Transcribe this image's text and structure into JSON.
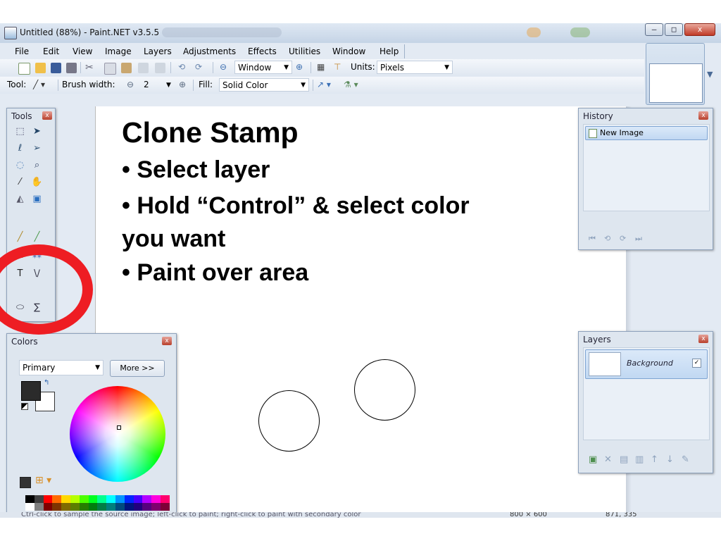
{
  "window": {
    "title": "Untitled (88%) - Paint.NET v3.5.5",
    "buttons": {
      "minimize": "–",
      "maximize": "□",
      "close": "x"
    }
  },
  "menu": [
    "File",
    "Edit",
    "View",
    "Image",
    "Layers",
    "Adjustments",
    "Effects",
    "Utilities",
    "Window",
    "Help"
  ],
  "toolbar1": {
    "zoom_mode": "Window",
    "units_label": "Units:",
    "units_value": "Pixels"
  },
  "toolbar2": {
    "tool_label": "Tool:",
    "brush_width_label": "Brush width:",
    "brush_width_value": "2",
    "fill_label": "Fill:",
    "fill_value": "Solid Color"
  },
  "panels": {
    "tools": {
      "title": "Tools"
    },
    "history": {
      "title": "History",
      "items": [
        "New Image"
      ]
    },
    "layers": {
      "title": "Layers",
      "items": [
        {
          "name": "Background",
          "visible": true
        }
      ]
    },
    "colors": {
      "title": "Colors",
      "mode": "Primary",
      "more_label": "More >>"
    }
  },
  "colors": {
    "primary": "#2b2b2b",
    "secondary": "#ffffff",
    "highlight_ring": "#ee1d23",
    "palette": [
      "#000000",
      "#404040",
      "#ff0000",
      "#ff6a00",
      "#ffd800",
      "#b6ff00",
      "#4cff00",
      "#00ff21",
      "#00ff90",
      "#00ffff",
      "#0094ff",
      "#0026ff",
      "#4800ff",
      "#b200ff",
      "#ff00dc",
      "#ff006e",
      "#ffffff",
      "#808080",
      "#7f0000",
      "#7f3300",
      "#7f6a00",
      "#5b7f00",
      "#267f00",
      "#007f0e",
      "#007f46",
      "#007f7f",
      "#004a7f",
      "#00137f",
      "#21007f",
      "#57007f",
      "#7f006e",
      "#7f0037"
    ]
  },
  "status": {
    "hint": "Ctrl-click to sample the source image; left-click to paint; right-click to paint with secondary color",
    "size": "800 × 600",
    "coords": "871, 335"
  },
  "slide": {
    "title": "Clone Stamp",
    "bullets": [
      "• Select layer",
      "• Hold “Control” & select color",
      "you want",
      "• Paint over area"
    ]
  }
}
